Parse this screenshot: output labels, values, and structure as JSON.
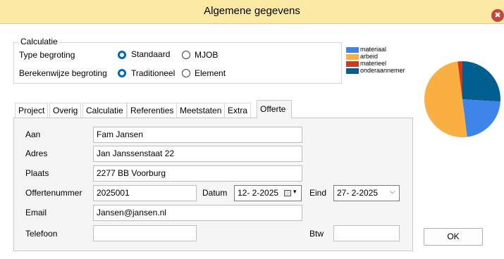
{
  "window": {
    "title": "Algemene gegevens",
    "close_glyph": "✖"
  },
  "calculatie": {
    "legend": "Calculatie",
    "type_label": "Type begroting",
    "type_options": [
      "Standaard",
      "MJOB"
    ],
    "type_selected": "Standaard",
    "method_label": "Berekenwijze begroting",
    "method_options": [
      "Traditioneel",
      "Element"
    ],
    "method_selected": "Traditioneel"
  },
  "chart_data": {
    "type": "pie",
    "categories": [
      "materiaal",
      "arbeid",
      "materieel",
      "onderaannemer"
    ],
    "values": [
      22,
      50,
      2,
      26
    ],
    "colors": [
      "#3d85e8",
      "#f9b040",
      "#cc3b1d",
      "#005f8e"
    ],
    "legend_position": "top-left"
  },
  "tabs": [
    "Project",
    "Overig",
    "Calculatie",
    "Referenties",
    "Meetstaten",
    "Extra",
    "Offerte"
  ],
  "active_tab": "Offerte",
  "form": {
    "aan_label": "Aan",
    "aan_value": "Fam Jansen",
    "adres_label": "Adres",
    "adres_value": "Jan Janssenstaat 22",
    "plaats_label": "Plaats",
    "plaats_value": "2277 BB Voorburg",
    "offertenummer_label": "Offertenummer",
    "offertenummer_value": "2025001",
    "datum_label": "Datum",
    "datum_value": "12- 2-2025",
    "eind_label": "Eind",
    "eind_value": "27- 2-2025",
    "email_label": "Email",
    "email_value": "Jansen@jansen.nl",
    "telefoon_label": "Telefoon",
    "telefoon_value": "",
    "btw_label": "Btw",
    "btw_value": ""
  },
  "buttons": {
    "ok": "OK"
  }
}
